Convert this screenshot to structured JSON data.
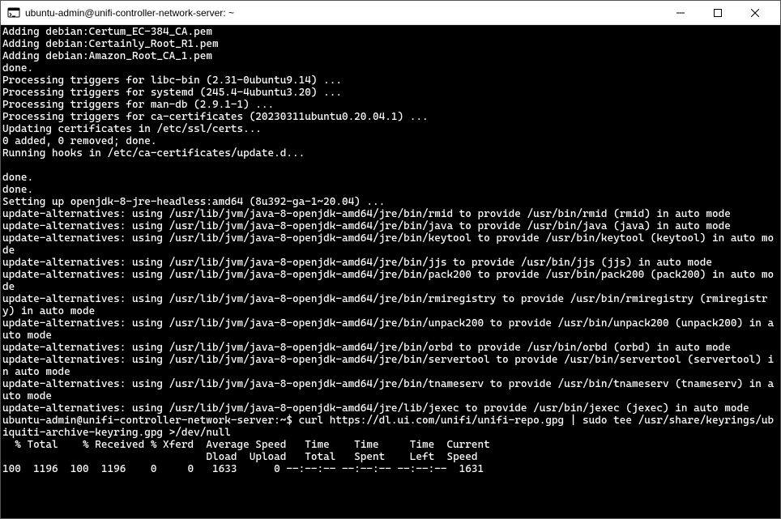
{
  "window": {
    "title": "ubuntu-admin@unifi-controller-network-server: ~"
  },
  "lines": {
    "l0": "Adding debian:Certum_EC-384_CA.pem",
    "l1": "Adding debian:Certainly_Root_R1.pem",
    "l2": "Adding debian:Amazon_Root_CA_1.pem",
    "l3": "done.",
    "l4": "Processing triggers for libc-bin (2.31-0ubuntu9.14) ...",
    "l5": "Processing triggers for systemd (245.4-4ubuntu3.20) ...",
    "l6": "Processing triggers for man-db (2.9.1-1) ...",
    "l7": "Processing triggers for ca-certificates (20230311ubuntu0.20.04.1) ...",
    "l8": "Updating certificates in /etc/ssl/certs...",
    "l9": "0 added, 0 removed; done.",
    "l10": "Running hooks in /etc/ca-certificates/update.d...",
    "l11": "done.",
    "l12": "done.",
    "l13": "Setting up openjdk-8-jre-headless:amd64 (8u392-ga-1~20.04) ...",
    "l14": "update-alternatives: using /usr/lib/jvm/java-8-openjdk-amd64/jre/bin/rmid to provide /usr/bin/rmid (rmid) in auto mode",
    "l15": "update-alternatives: using /usr/lib/jvm/java-8-openjdk-amd64/jre/bin/java to provide /usr/bin/java (java) in auto mode",
    "l16": "update-alternatives: using /usr/lib/jvm/java-8-openjdk-amd64/jre/bin/keytool to provide /usr/bin/keytool (keytool) in auto mode",
    "l17": "update-alternatives: using /usr/lib/jvm/java-8-openjdk-amd64/jre/bin/jjs to provide /usr/bin/jjs (jjs) in auto mode",
    "l18": "update-alternatives: using /usr/lib/jvm/java-8-openjdk-amd64/jre/bin/pack200 to provide /usr/bin/pack200 (pack200) in auto mode",
    "l19": "update-alternatives: using /usr/lib/jvm/java-8-openjdk-amd64/jre/bin/rmiregistry to provide /usr/bin/rmiregistry (rmiregistry) in auto mode",
    "l20": "update-alternatives: using /usr/lib/jvm/java-8-openjdk-amd64/jre/bin/unpack200 to provide /usr/bin/unpack200 (unpack200) in auto mode",
    "l21": "update-alternatives: using /usr/lib/jvm/java-8-openjdk-amd64/jre/bin/orbd to provide /usr/bin/orbd (orbd) in auto mode",
    "l22": "update-alternatives: using /usr/lib/jvm/java-8-openjdk-amd64/jre/bin/servertool to provide /usr/bin/servertool (servertool) in auto mode",
    "l23": "update-alternatives: using /usr/lib/jvm/java-8-openjdk-amd64/jre/bin/tnameserv to provide /usr/bin/tnameserv (tnameserv) in auto mode",
    "l24": "update-alternatives: using /usr/lib/jvm/java-8-openjdk-amd64/jre/lib/jexec to provide /usr/bin/jexec (jexec) in auto mode",
    "l25": "ubuntu-admin@unifi-controller-network-server:~$ curl https://dl.ui.com/unifi/unifi-repo.gpg | sudo tee /usr/share/keyrings/ubiquiti-archive-keyring.gpg >/dev/null",
    "l26": "  % Total    % Received % Xferd  Average Speed   Time    Time     Time  Current",
    "l27": "                                 Dload  Upload   Total   Spent    Left  Speed",
    "l28": "100  1196  100  1196    0     0   1633      0 --:--:-- --:--:-- --:--:--  1631"
  }
}
